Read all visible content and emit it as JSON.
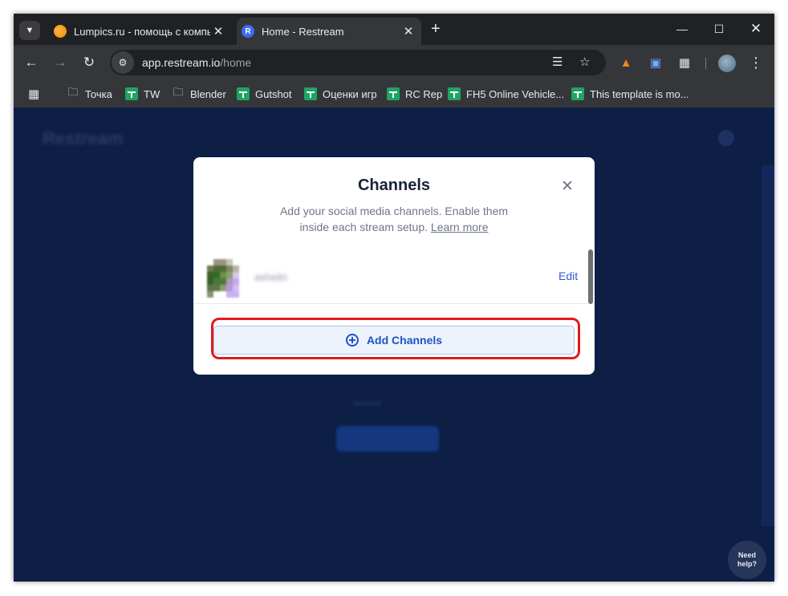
{
  "browser": {
    "tabs": [
      {
        "title": "Lumpics.ru - помощь с компьютером",
        "favicon": "lumpics-favicon",
        "active": false
      },
      {
        "title": "Home - Restream",
        "favicon": "restream-favicon",
        "favicon_letter": "R",
        "active": true
      }
    ],
    "url_host": "app.restream.io",
    "url_path": "/home"
  },
  "bookmarks": [
    {
      "label": "Точка",
      "icon": "folder-icon"
    },
    {
      "label": "TW",
      "icon": "sheets-icon"
    },
    {
      "label": "Blender",
      "icon": "folder-icon"
    },
    {
      "label": "Gutshot",
      "icon": "sheets-icon"
    },
    {
      "label": "Оценки игр",
      "icon": "sheets-icon"
    },
    {
      "label": "RC Rep",
      "icon": "sheets-icon"
    },
    {
      "label": "FH5 Online Vehicle...",
      "icon": "sheets-icon"
    },
    {
      "label": "This template is mo...",
      "icon": "sheets-icon"
    }
  ],
  "page": {
    "logo": "Restream",
    "help_button": "Need help?"
  },
  "modal": {
    "title": "Channels",
    "description": "Add your social media channels. Enable them inside each stream setup.",
    "learn_more": "Learn more",
    "channel": {
      "name": "ashelin",
      "edit_label": "Edit"
    },
    "add_button": "Add Channels"
  },
  "colors": {
    "page_bg": "#0d1f45",
    "accent": "#1f53c6",
    "highlight": "#e11a1a",
    "sheets_green": "#1fa463"
  }
}
